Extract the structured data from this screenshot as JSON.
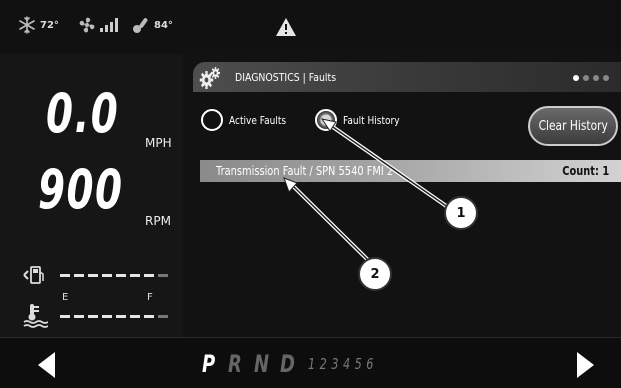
{
  "status": {
    "ambient_temp": "72°",
    "engine_temp": "84°",
    "snowflake_icon": "snowflake-icon",
    "fan_icon": "fan-icon",
    "signal_icon": "signal-bars-icon",
    "thermometer_icon": "thermometer-icon",
    "warning_icon": "warning-triangle-icon"
  },
  "gauges": {
    "speed": "0.0",
    "speed_unit": "MPH",
    "rpm": "900",
    "rpm_unit": "RPM",
    "fuel_empty": "E",
    "fuel_full": "F"
  },
  "header": {
    "title": "DIAGNOSTICS | Faults",
    "page_count": 4,
    "current_page": 1
  },
  "filters": {
    "active_faults": "Active Faults",
    "fault_history": "Fault History",
    "selected": "Fault History"
  },
  "clear_button": "Clear History",
  "faults": [
    {
      "text": "Transmission Fault / SPN 5540 FMI 2",
      "count": "Count: 1"
    }
  ],
  "callouts": [
    "1",
    "2"
  ],
  "gear_selector": {
    "gears": [
      "P",
      "R",
      "N",
      "D"
    ],
    "active": "P",
    "manual_gears": "123456"
  },
  "colors": {
    "background": "#1a1a1a",
    "fault_row": "#a6a6a6",
    "text": "#ffffff"
  }
}
